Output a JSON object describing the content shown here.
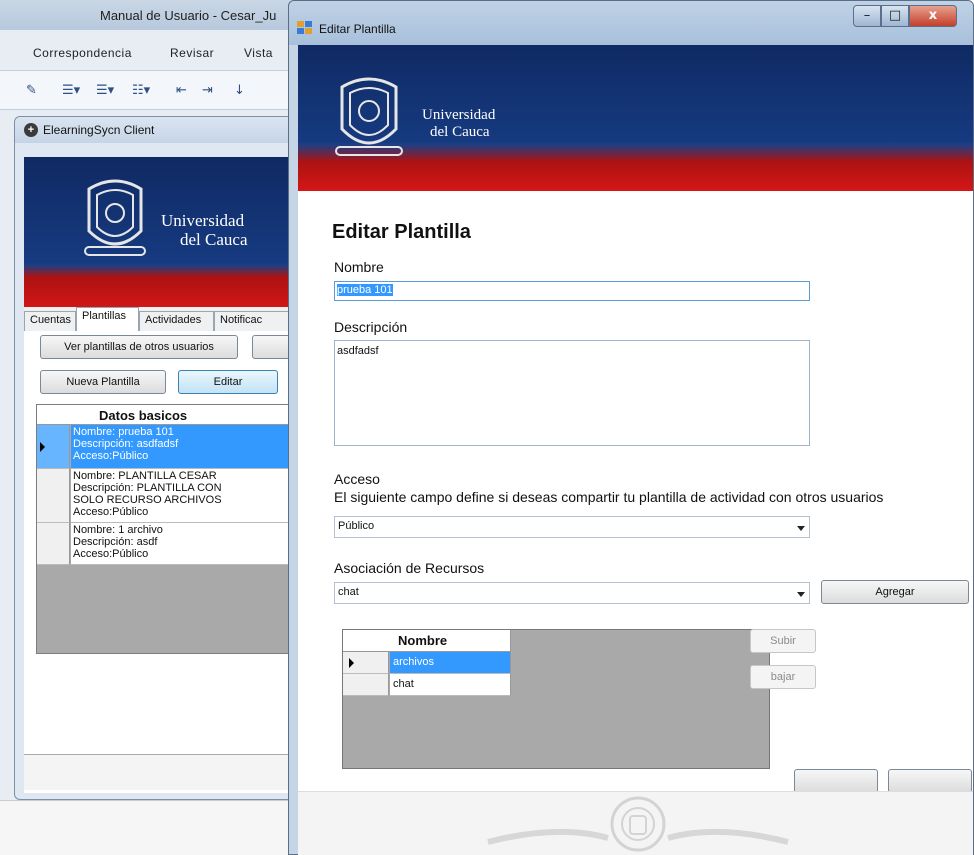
{
  "word": {
    "title": "Manual de Usuario - Cesar_Ju",
    "menu": [
      "Correspondencia",
      "Revisar",
      "Vista"
    ]
  },
  "client": {
    "title": "ElearningSycn Client",
    "university_line1": "Universidad",
    "university_line2": "del Cauca",
    "tabs": [
      "Cuentas",
      "Plantillas",
      "Actividades",
      "Notificac"
    ],
    "btn_ver_plantillas": "Ver plantillas de otros usuarios",
    "btn_nueva": "Nueva Plantilla",
    "btn_editar": "Editar",
    "grid_header": "Datos basicos",
    "rows": [
      {
        "lines": [
          "Nombre: prueba 101",
          "Descripción: asdfadsf",
          "Acceso:Público"
        ],
        "selected": true
      },
      {
        "lines": [
          "Nombre: PLANTILLA CESAR",
          "Descripción: PLANTILLA CON",
          "SOLO RECURSO ARCHIVOS",
          "Acceso:Público"
        ],
        "selected": false
      },
      {
        "lines": [
          "Nombre: 1 archivo",
          "Descripción: asdf",
          "Acceso:Público"
        ],
        "selected": false
      }
    ]
  },
  "dialog": {
    "title": "Editar Plantilla",
    "btn_minimize": "–",
    "btn_maximize": "□",
    "btn_close": "x",
    "university_line1": "Universidad",
    "university_line2": "del Cauca",
    "heading": "Editar Plantilla",
    "nombre_label": "Nombre",
    "nombre_value": "prueba 101",
    "descripcion_label": "Descripción",
    "descripcion_value": "asdfadsf",
    "acceso_label": "Acceso",
    "acceso_help": "El siguiente campo define si deseas compartir tu plantilla de actividad con otros usuarios",
    "acceso_value": "Público",
    "recursos_label": "Asociación de Recursos",
    "recursos_value": "chat",
    "btn_agregar": "Agregar",
    "grid_header": "Nombre",
    "resources": [
      {
        "name": "archivos",
        "selected": true
      },
      {
        "name": "chat",
        "selected": false
      }
    ],
    "btn_subir": "Subir",
    "btn_bajar": "bajar"
  },
  "colors": {
    "banner_blue": "#163a80",
    "banner_red": "#d01616",
    "selection": "#3399ff"
  }
}
